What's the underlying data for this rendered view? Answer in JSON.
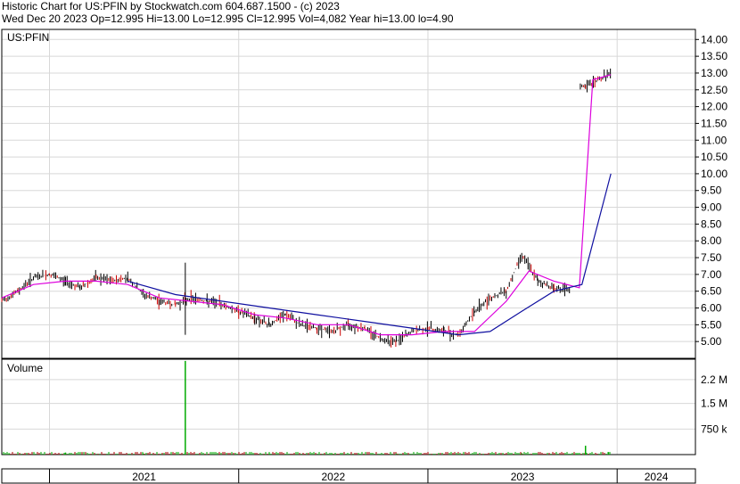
{
  "header": {
    "line1": "Historic Chart for US:PFIN by Stockwatch.com 604.687.1500 - (c) 2023",
    "line2": "Wed Dec 20 2023   Op=12.995   Hi=13.00   Lo=12.995   Cl=12.995   Vol=4,082   Year hi=13.00   lo=4.90"
  },
  "colors": {
    "background": "#ffffff",
    "grid": "#d8d8d8",
    "frame": "#000000",
    "price_bar": "#000000",
    "price_down": "#cc0000",
    "ma_short": "#dd00dd",
    "ma_long": "#1010a0",
    "volume_spike": "#00aa00",
    "volume_base": "#aa0000"
  },
  "chart_data": [
    {
      "type": "line",
      "panel": "price",
      "title": "US:PFIN",
      "ylim": [
        4.5,
        14.3
      ],
      "y_ticks": [
        "14.00",
        "13.50",
        "13.00",
        "12.50",
        "12.00",
        "11.50",
        "11.00",
        "10.50",
        "10.00",
        "9.50",
        "9.00",
        "8.50",
        "8.00",
        "7.50",
        "7.00",
        "6.50",
        "6.00",
        "5.50",
        "5.00"
      ],
      "x_ticks": [
        "2021",
        "2022",
        "2023",
        "2024"
      ],
      "x_range": [
        "2020-10-01",
        "2024-05-31"
      ],
      "series": [
        {
          "role": "price",
          "x": [
            "2020-10-01",
            "2020-11-01",
            "2020-12-01",
            "2021-01-01",
            "2021-02-01",
            "2021-03-01",
            "2021-04-01",
            "2021-05-01",
            "2021-06-01",
            "2021-07-01",
            "2021-08-01",
            "2021-09-01",
            "2021-10-01",
            "2021-11-01",
            "2021-12-01",
            "2022-01-01",
            "2022-02-01",
            "2022-03-01",
            "2022-04-01",
            "2022-05-01",
            "2022-06-01",
            "2022-07-01",
            "2022-08-01",
            "2022-09-01",
            "2022-10-01",
            "2022-11-01",
            "2022-12-01",
            "2023-01-01",
            "2023-02-01",
            "2023-03-01",
            "2023-04-01",
            "2023-05-01",
            "2023-06-01",
            "2023-07-01",
            "2023-08-01",
            "2023-09-01",
            "2023-10-01",
            "2023-11-01",
            "2023-12-20"
          ],
          "values": [
            6.2,
            6.5,
            6.9,
            7.0,
            6.8,
            6.6,
            6.9,
            6.8,
            6.9,
            6.4,
            6.2,
            6.1,
            6.3,
            6.2,
            6.1,
            5.9,
            5.7,
            5.5,
            5.8,
            5.5,
            5.4,
            5.3,
            5.5,
            5.4,
            5.1,
            5.0,
            5.3,
            5.4,
            5.3,
            5.2,
            5.9,
            6.3,
            6.5,
            7.6,
            6.8,
            6.6,
            6.5,
            12.6,
            12.995
          ]
        },
        {
          "role": "ma_short",
          "x": [
            "2020-10-01",
            "2020-12-01",
            "2021-02-01",
            "2021-04-01",
            "2021-06-01",
            "2021-08-01",
            "2021-10-01",
            "2021-12-01",
            "2022-02-01",
            "2022-04-01",
            "2022-06-01",
            "2022-08-01",
            "2022-10-01",
            "2022-12-01",
            "2023-02-01",
            "2023-04-01",
            "2023-06-01",
            "2023-07-15",
            "2023-09-01",
            "2023-10-20",
            "2023-11-15",
            "2023-12-20"
          ],
          "values": [
            6.3,
            6.7,
            6.8,
            6.8,
            6.7,
            6.3,
            6.2,
            6.1,
            5.8,
            5.7,
            5.5,
            5.5,
            5.2,
            5.2,
            5.3,
            5.3,
            6.2,
            7.1,
            6.8,
            6.6,
            12.8,
            12.95
          ]
        },
        {
          "role": "ma_long",
          "x": [
            "2021-06-01",
            "2021-09-01",
            "2021-12-01",
            "2022-03-01",
            "2022-06-01",
            "2022-09-01",
            "2022-12-01",
            "2023-03-01",
            "2023-05-01",
            "2023-07-01",
            "2023-09-01",
            "2023-10-25",
            "2023-12-20"
          ],
          "values": [
            6.8,
            6.4,
            6.2,
            6.0,
            5.8,
            5.6,
            5.4,
            5.2,
            5.3,
            5.9,
            6.5,
            6.7,
            10.0
          ]
        }
      ]
    },
    {
      "type": "bar",
      "panel": "volume",
      "title": "Volume",
      "ylim": [
        0,
        2800000
      ],
      "y_ticks": [
        "2.2 M",
        "1.5 M",
        "750 k"
      ],
      "x_ticks": [
        "2021",
        "2022",
        "2023",
        "2024"
      ],
      "x_range": [
        "2020-10-01",
        "2024-05-31"
      ],
      "x": [
        "2020-10-15",
        "2021-02-01",
        "2021-07-01",
        "2021-09-20",
        "2022-03-01",
        "2022-07-01",
        "2022-11-01",
        "2023-03-01",
        "2023-07-01",
        "2023-10-15",
        "2023-11-01",
        "2023-12-15"
      ],
      "values": [
        40000,
        60000,
        30000,
        2750000,
        30000,
        20000,
        30000,
        20000,
        40000,
        20000,
        260000,
        70000
      ]
    }
  ]
}
